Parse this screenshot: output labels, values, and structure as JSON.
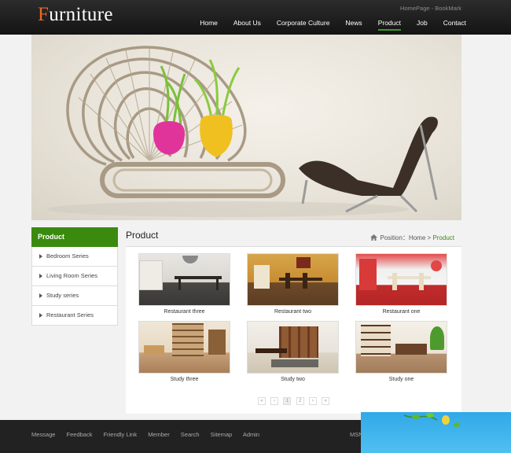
{
  "header": {
    "logo_first": "F",
    "logo_rest": "urniture",
    "toplinks": {
      "homepage": "HomePage",
      "sep": " - ",
      "bookmark": "BookMark"
    }
  },
  "nav": [
    {
      "label": "Home"
    },
    {
      "label": "About Us"
    },
    {
      "label": "Corporate Culture"
    },
    {
      "label": "News"
    },
    {
      "label": "Product",
      "active": true
    },
    {
      "label": "Job"
    },
    {
      "label": "Contact"
    }
  ],
  "sidebar": {
    "title": "Product",
    "items": [
      {
        "label": "Bedroom Series"
      },
      {
        "label": "Living Room Series"
      },
      {
        "label": "Study series"
      },
      {
        "label": "Restaurant Series"
      }
    ]
  },
  "content": {
    "title": "Product",
    "breadcrumb": {
      "prefix": "Position：",
      "home": "Home",
      "sep": " > ",
      "current": "Product"
    }
  },
  "products": [
    {
      "caption": "Restaurant three"
    },
    {
      "caption": "Restaurant two"
    },
    {
      "caption": "Restaurant one"
    },
    {
      "caption": "Study three"
    },
    {
      "caption": "Study two"
    },
    {
      "caption": "Study one"
    }
  ],
  "pager": {
    "first": "«",
    "prev": "‹",
    "pages": [
      "1",
      "2"
    ],
    "next": "›",
    "last": "»"
  },
  "footer": {
    "links": [
      "Message",
      "Feedback",
      "Friendly Link",
      "Member",
      "Search",
      "Sitemap",
      "Admin"
    ],
    "msn": "MSN"
  },
  "colors": {
    "accent": "#3b8a10",
    "logo_accent": "#e8692b",
    "header_bg": "#1e1e1e"
  }
}
